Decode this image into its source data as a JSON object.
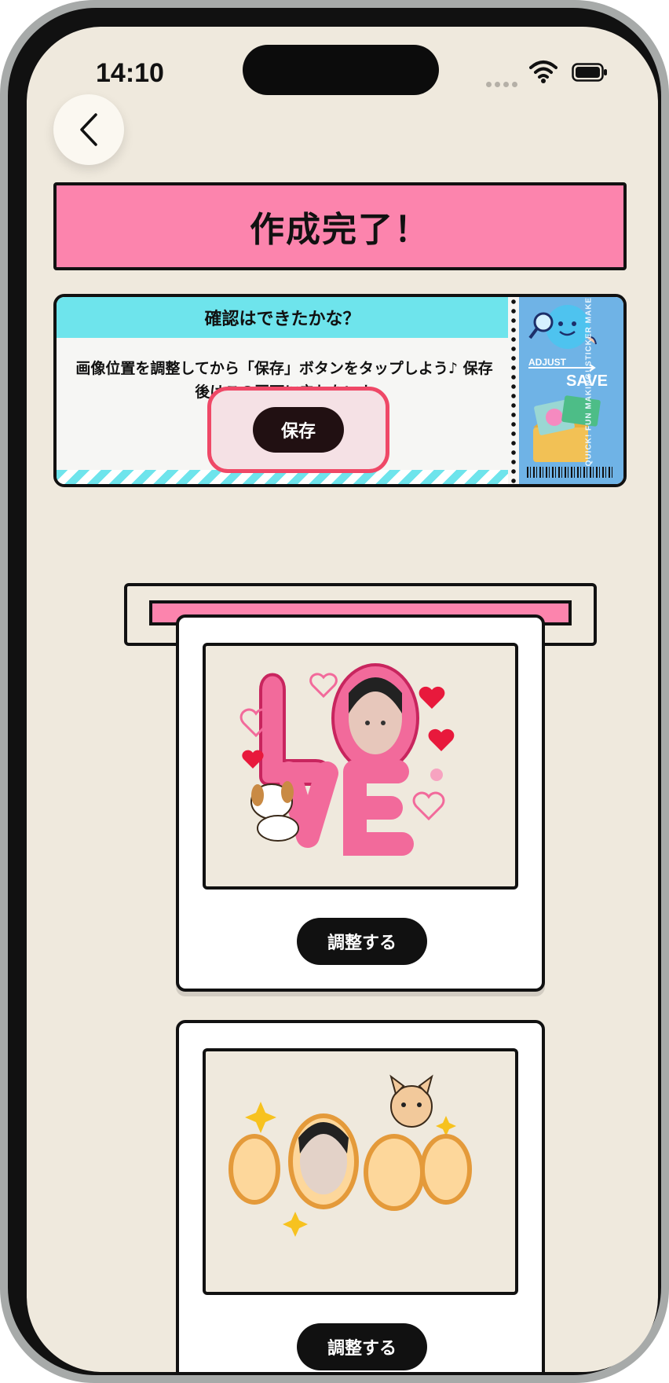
{
  "status_bar": {
    "time": "14:10"
  },
  "header": {
    "back_icon": "chevron-left-icon"
  },
  "title": "作成完了！",
  "confirm": {
    "heading": "確認はできたかな？",
    "message": "画像位置を調整してから「保存」ボタンをタップしよう♪ 保存後はこの画面に戻れないよ",
    "save_label": "保存",
    "ticket": {
      "adjust": "ADJUST",
      "save": "SAVE",
      "vertical": "QUICK! FUN MAKING! STICKER MAKER"
    }
  },
  "stickers": [
    {
      "name": "love-sticker",
      "adjust_label": "調整する"
    },
    {
      "name": "good-sticker",
      "adjust_label": "調整する"
    }
  ]
}
